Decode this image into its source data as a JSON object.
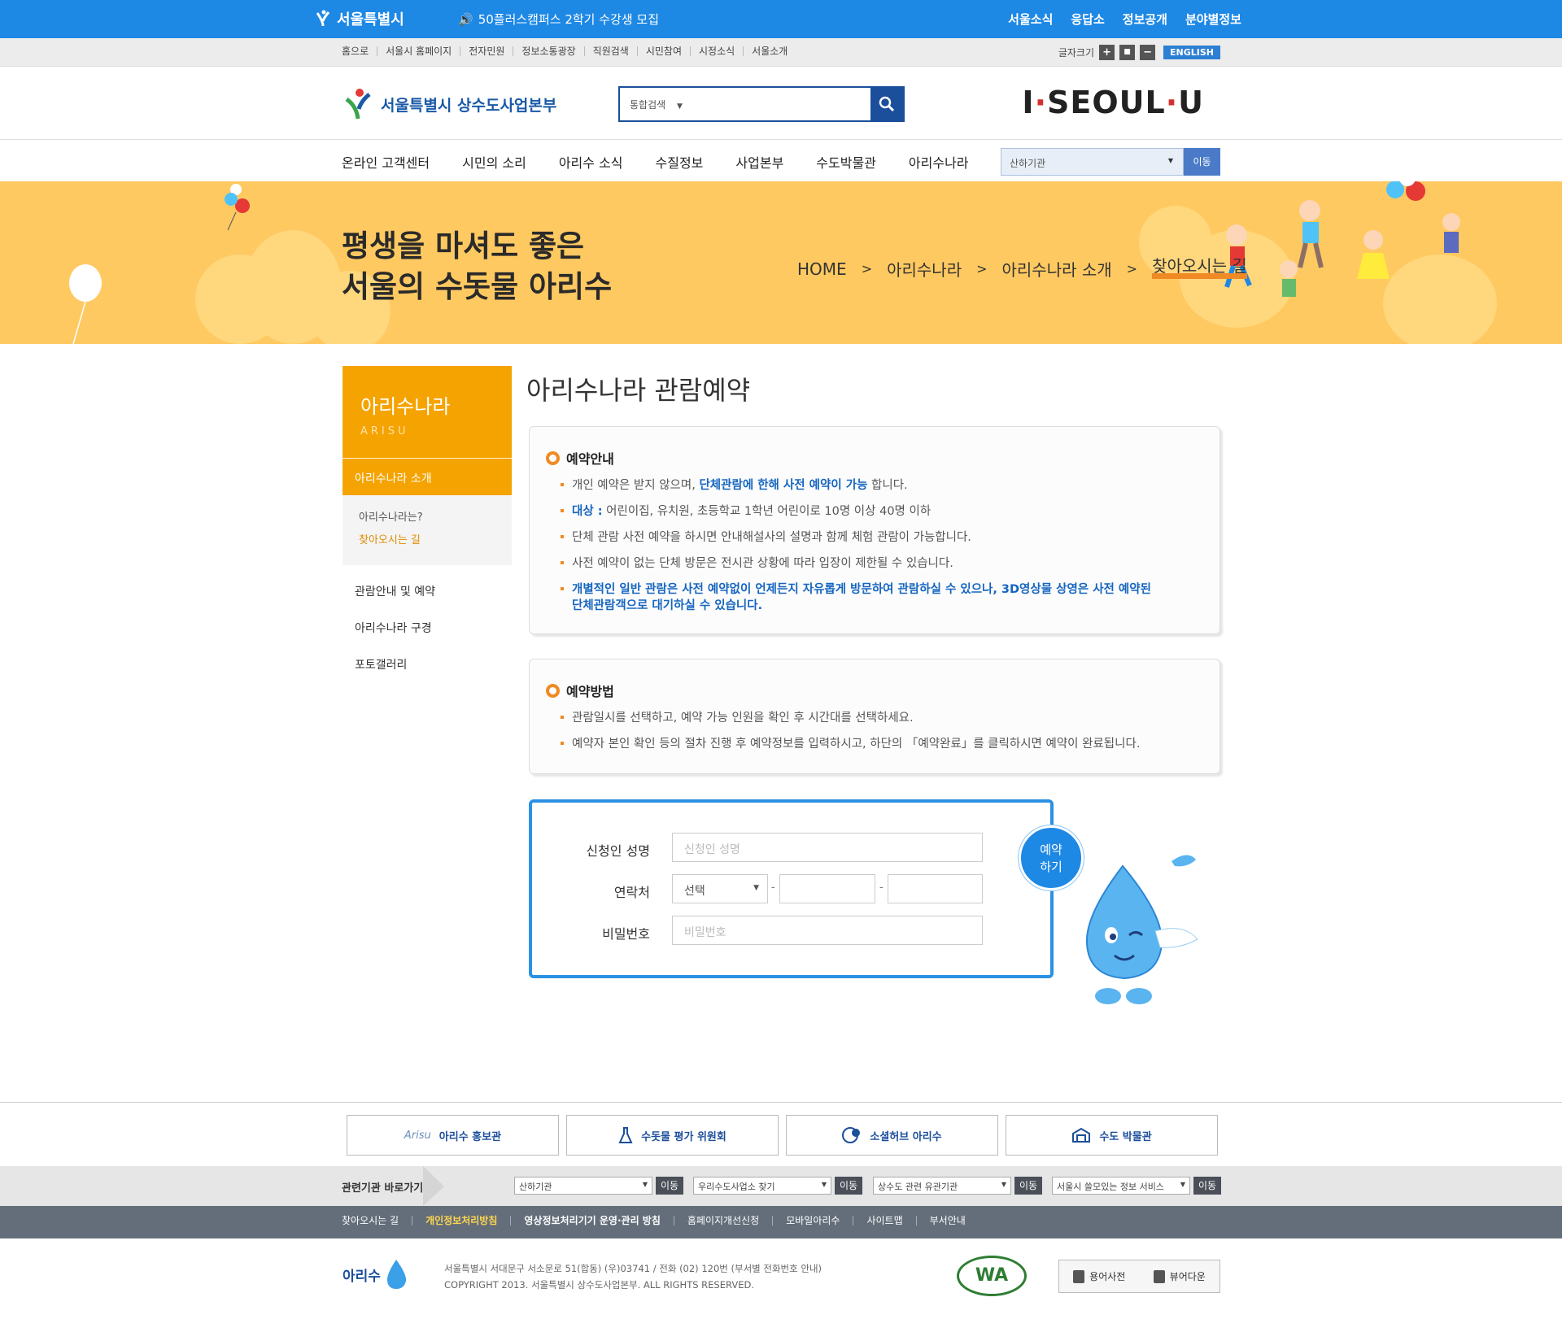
{
  "topbar": {
    "logo": "서울특별시",
    "notice": "50플러스캠퍼스 2학기 수강생 모집",
    "links": [
      "서울소식",
      "응답소",
      "정보공개",
      "분야별정보"
    ]
  },
  "util": {
    "links": [
      "홈으로",
      "서울시 홈페이지",
      "전자민원",
      "정보소통광장",
      "직원검색",
      "시민참여",
      "시정소식",
      "서울소개"
    ],
    "font_size_label": "글자크기",
    "font_plus": "+",
    "font_reset": "■",
    "font_minus": "−",
    "english": "ENGLISH"
  },
  "header": {
    "logo": "서울특별시 상수도사업본부",
    "search_select": "통합검색",
    "brand_left": "I",
    "brand_mid": "SEOUL",
    "brand_right": "U"
  },
  "nav": {
    "items": [
      "온라인 고객센터",
      "시민의 소리",
      "아리수 소식",
      "수질정보",
      "사업본부",
      "수도박물관",
      "아리수나라"
    ],
    "select": "산하기관",
    "go": "이동"
  },
  "banner": {
    "line1": "평생을 마셔도 좋은",
    "line2": "서울의 수돗물 아리수",
    "crumbs": [
      "HOME",
      "아리수나라",
      "아리수나라 소개",
      "찾아오시는 길"
    ]
  },
  "sidebar": {
    "title": "아리수나라",
    "title_en": "ARISU",
    "active": "아리수나라 소개",
    "sub": [
      "아리수나라는?",
      "찾아오시는 길"
    ],
    "menu": [
      "관람안내 및 예약",
      "아리수나라 구경",
      "포토갤러리"
    ]
  },
  "content": {
    "title": "아리수나라 관람예약",
    "guide": {
      "heading": "예약안내",
      "l1a": "개인 예약은 받지 않으며,",
      "l1b": "단체관람에 한해 사전 예약이 가능",
      "l1c": "합니다.",
      "l2a": "대상 :",
      "l2b": "어린이집, 유치원, 초등학교 1학년 어린이로 10명 이상 40명 이하",
      "l3": "단체 관람 사전 예약을 하시면 안내해설사의 설명과 함께 체험 관람이 가능합니다.",
      "l4": "사전 예약이 없는 단체 방문은 전시관 상황에 따라 입장이 제한될 수 있습니다.",
      "l5a": "개별적인 일반 관람은 사전 예약없이 언제든지 자유롭게 방문하여 관람하실 수 있으나, 3D영상물 상영은 사전 예약된",
      "l5b": "단체관람객으로 대기하실 수 있습니다."
    },
    "method": {
      "heading": "예약방법",
      "l1": "관람일시를 선택하고, 예약 가능 인원을 확인 후 시간대를 선택하세요.",
      "l2": "예약자 본인 확인 등의 절차 진행 후 예약정보를 입력하시고, 하단의 「예약완료」를 클릭하시면 예약이 완료됩니다."
    },
    "form": {
      "name_label": "신청인 성명",
      "name_placeholder": "신청인 성명",
      "phone_label": "연락처",
      "phone_select": "선택",
      "password_label": "비밀번호",
      "password_placeholder": "비밀번호",
      "reserve_btn_1": "예약",
      "reserve_btn_2": "하기"
    }
  },
  "footer": {
    "buttons": [
      "아리수 홍보관",
      "수돗물 평가 위원회",
      "소셜허브 아리수",
      "수도 박물관"
    ],
    "arisu_logo": "Arisu",
    "related_label": "관련기관 바로가기",
    "related": [
      {
        "select": "산하기관",
        "go": "이동"
      },
      {
        "select": "우리수도사업소 찾기",
        "go": "이동"
      },
      {
        "select": "상수도 관련 유관기관",
        "go": "이동"
      },
      {
        "select": "서울시 쓸모있는 정보 서비스",
        "go": "이동"
      }
    ],
    "links": [
      "찾아오시는 길",
      "개인정보처리방침",
      "영상정보처리기기 운영·관리 방침",
      "홈페이지개선신청",
      "모바일아리수",
      "사이트맵",
      "부서안내"
    ],
    "logo": "아리수",
    "address": "서울특별시 서대문구 서소문로 51(합동) (우)03741 / 전화 (02) 120번 (부서별 전화번호 안내)",
    "copyright": "COPYRIGHT 2013. 서울특별시 상수도사업본부. ALL RIGHTS RESERVED.",
    "wa": "WA",
    "glossary": "용어사전",
    "viewer": "뷰어다운"
  },
  "colors": {
    "topbar": "#1e88e5",
    "banner": "#ffc961",
    "accent": "#f5a300",
    "link_blue": "#1565c0"
  }
}
